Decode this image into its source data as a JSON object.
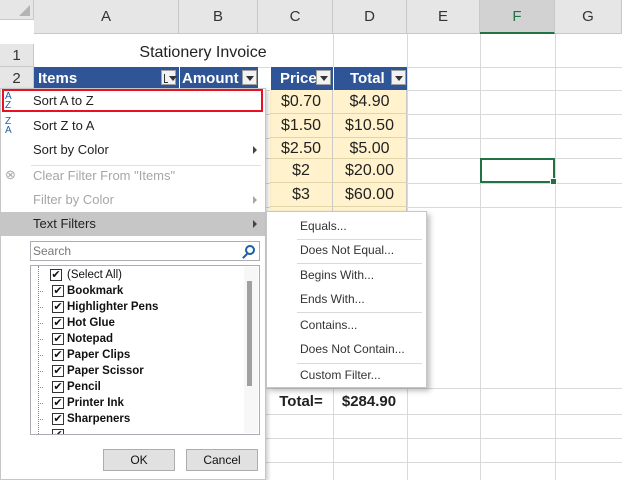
{
  "sheet": {
    "columns": [
      "A",
      "B",
      "C",
      "D",
      "E",
      "F",
      "G"
    ],
    "selected_column": "F",
    "rows": [
      "1",
      "2"
    ],
    "title": "Stationery Invoice",
    "headers": {
      "items": "Items",
      "amount": "Amount",
      "price": "Price",
      "total": "Total"
    },
    "price_values": [
      "$0.70",
      "$1.50",
      "$2.50",
      "$2",
      "$3"
    ],
    "total_values": [
      "$4.90",
      "$10.50",
      "$5.00",
      "$20.00",
      "$60.00"
    ],
    "grand_total_label": "Total=",
    "grand_total_value": "$284.90"
  },
  "filter_menu": {
    "sort_az": "Sort A to Z",
    "sort_za": "Sort Z to A",
    "sort_by_color": "Sort by Color",
    "clear_filter": "Clear Filter From \"Items\"",
    "filter_by_color": "Filter by Color",
    "text_filters": "Text Filters",
    "search_placeholder": "Search",
    "list": [
      "(Select All)",
      "Bookmark",
      "Highlighter Pens",
      "Hot Glue",
      "Notepad",
      "Paper Clips",
      "Paper Scissor",
      "Pencil",
      "Printer Ink",
      "Sharpeners"
    ],
    "ok": "OK",
    "cancel": "Cancel"
  },
  "text_filters_submenu": {
    "equals": "Equals...",
    "does_not_equal": "Does Not Equal...",
    "begins_with": "Begins With...",
    "ends_with": "Ends With...",
    "contains": "Contains...",
    "does_not_contain": "Does Not Contain...",
    "custom_filter": "Custom Filter..."
  },
  "colors": {
    "header_blue": "#2f5597",
    "cell_yellow": "#fff2cc",
    "accent_green": "#217346",
    "highlight_red": "#e81123"
  }
}
